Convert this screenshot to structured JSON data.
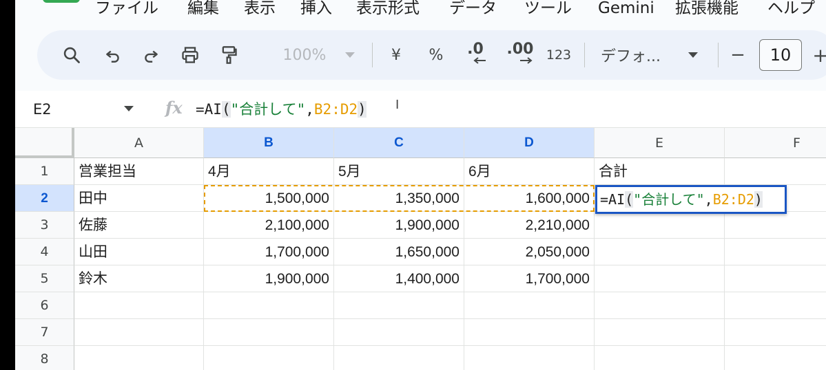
{
  "menu": [
    "ファイル",
    "編集",
    "表示",
    "挿入",
    "表示形式",
    "データ",
    "ツール",
    "Gemini",
    "拡張機能",
    "ヘルプ"
  ],
  "toolbar": {
    "zoom": "100%",
    "currency": "¥",
    "percent": "%",
    "decrease_decimal": ".0",
    "increase_decimal": ".00",
    "number_format": "123",
    "font": "デフォ...",
    "font_size": "10",
    "minus": "−",
    "plus": "+"
  },
  "formula_bar": {
    "name_box": "E2",
    "fx": "fx",
    "formula": {
      "prefix": "=AI",
      "open": "(",
      "string": "\"合計して\"",
      "comma": ",",
      "range": "B2:D2",
      "close": ")"
    }
  },
  "grid": {
    "columns": [
      "A",
      "B",
      "C",
      "D",
      "E",
      "F"
    ],
    "selected_columns": [
      "B",
      "C",
      "D"
    ],
    "rows": [
      "1",
      "2",
      "3",
      "4",
      "5",
      "6",
      "7",
      "8"
    ],
    "selected_row": "2",
    "cells": [
      [
        "営業担当",
        "4月",
        "5月",
        "6月",
        "合計",
        ""
      ],
      [
        "田中",
        "1,500,000",
        "1,350,000",
        "1,600,000",
        "",
        ""
      ],
      [
        "佐藤",
        "2,100,000",
        "1,900,000",
        "2,210,000",
        "",
        ""
      ],
      [
        "山田",
        "1,700,000",
        "1,650,000",
        "2,050,000",
        "",
        ""
      ],
      [
        "鈴木",
        "1,900,000",
        "1,400,000",
        "1,700,000",
        "",
        ""
      ],
      [
        "",
        "",
        "",
        "",
        "",
        ""
      ],
      [
        "",
        "",
        "",
        "",
        "",
        ""
      ],
      [
        "",
        "",
        "",
        "",
        "",
        ""
      ]
    ],
    "active_cell": "E2"
  },
  "colors": {
    "accent_blue": "#1a56c4",
    "selection_header": "#d3e3fd",
    "copy_range": "#e69c00",
    "formula_string": "#188038"
  }
}
